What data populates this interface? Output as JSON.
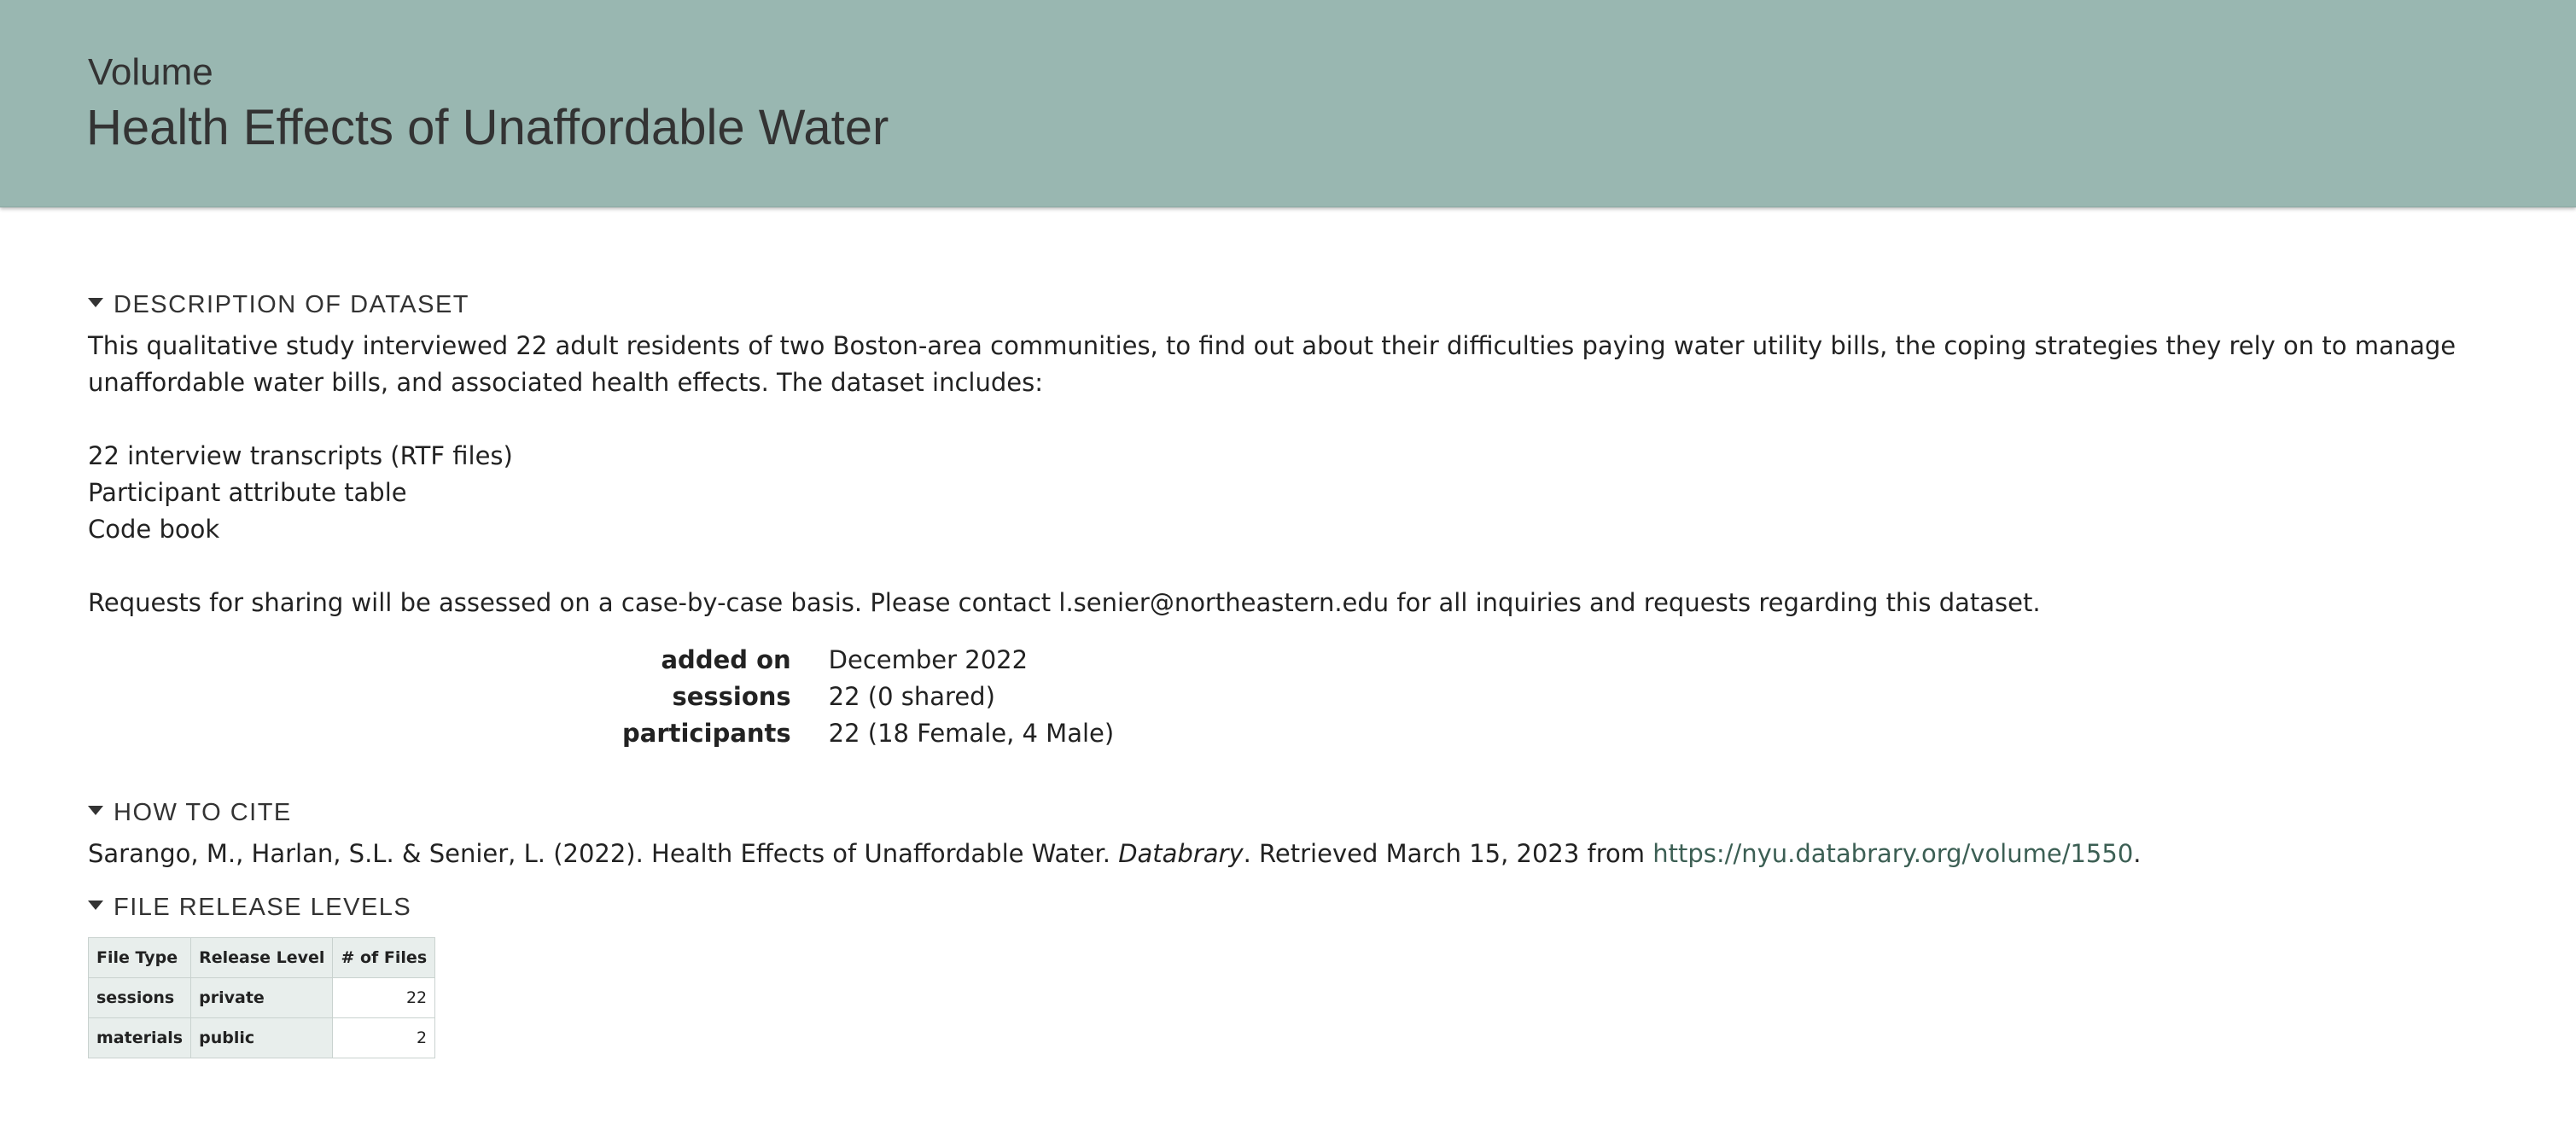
{
  "header": {
    "type_label": "Volume",
    "title": "Health Effects of Unaffordable Water"
  },
  "description": {
    "section_label": "DESCRIPTION OF DATASET",
    "paragraph1": "This qualitative study interviewed 22 adult residents of two Boston-area communities, to find out about their difficulties paying water utility bills, the coping strategies they rely on to manage unaffordable water bills, and associated health effects. The dataset includes:",
    "items": [
      "22 interview transcripts (RTF files)",
      "Participant attribute table",
      "Code book"
    ],
    "paragraph2": "Requests for sharing will be assessed on a case-by-case basis. Please contact l.senier@northeastern.edu for all inquiries and requests regarding this dataset."
  },
  "meta": [
    {
      "key": "added on",
      "value": "December 2022"
    },
    {
      "key": "sessions",
      "value": "22 (0 shared)"
    },
    {
      "key": "participants",
      "value": "22 (18 Female, 4 Male)"
    }
  ],
  "cite": {
    "section_label": "HOW TO CITE",
    "authors": "Sarango, M., Harlan, S.L. & Senier, L. (2022). Health Effects of Unaffordable Water.",
    "source": "Databrary",
    "retrieved": ". Retrieved March 15, 2023 from",
    "url": "https://nyu.databrary.org/volume/1550",
    "end": "."
  },
  "file_release": {
    "section_label": "FILE RELEASE LEVELS",
    "headers": [
      "File Type",
      "Release Level",
      "# of Files"
    ],
    "rows": [
      [
        "sessions",
        "private",
        "22"
      ],
      [
        "materials",
        "public",
        "2"
      ]
    ]
  },
  "colors": {
    "header_bg": "#99b7b1",
    "link": "#3c5f54"
  }
}
